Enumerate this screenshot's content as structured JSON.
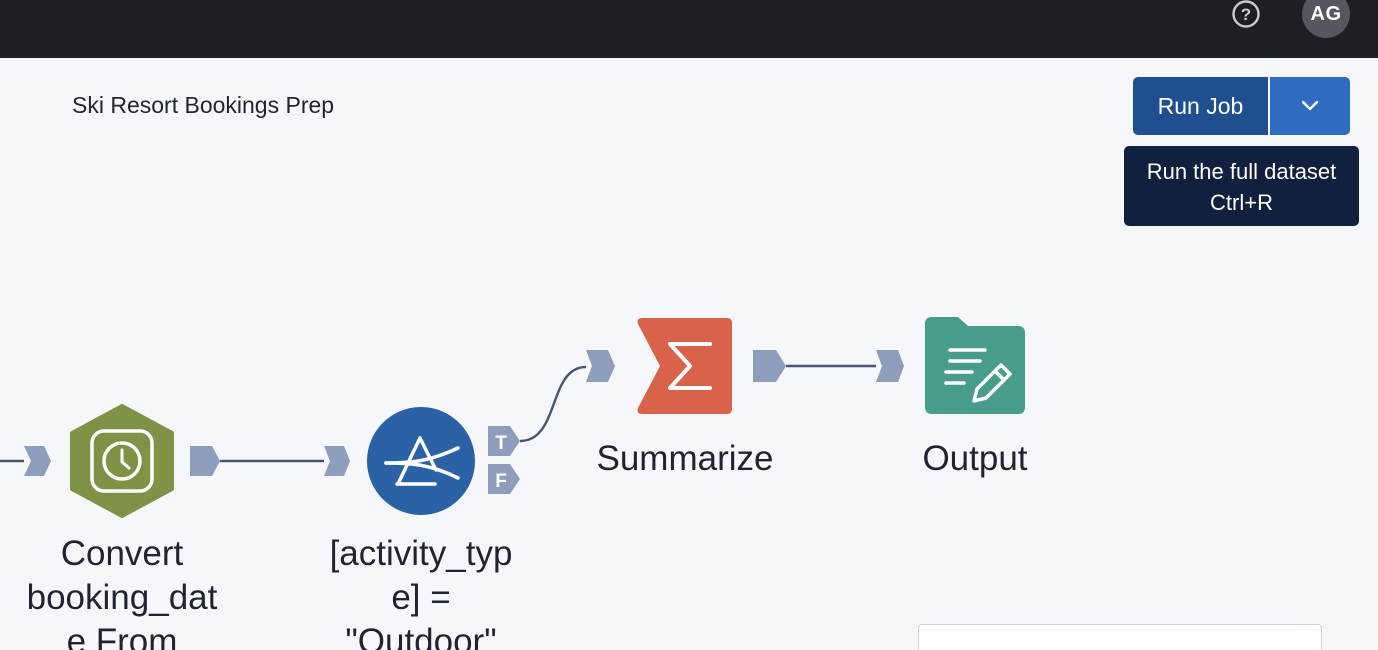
{
  "header": {
    "help_icon": "question-circle-icon",
    "avatar_initials": "AG"
  },
  "workflow": {
    "title": "Ski Resort Bookings Prep"
  },
  "run": {
    "button_label": "Run Job",
    "dropdown_icon": "chevron-down-icon",
    "tooltip_line1": "Run the full dataset",
    "tooltip_line2": "Ctrl+R"
  },
  "nodes": {
    "datetime": {
      "label_lines": [
        "Convert",
        "booking_dat",
        "e From"
      ],
      "icon": "clock-icon",
      "color": "#7f9245"
    },
    "filter": {
      "label_lines": [
        "[activity_typ",
        "e] =",
        "\"Outdoor\""
      ],
      "icon": "filter-icon",
      "color": "#2a62a5",
      "true_anchor": "T",
      "false_anchor": "F"
    },
    "summarize": {
      "label": "Summarize",
      "icon": "sigma-icon",
      "color": "#d9624b"
    },
    "output": {
      "label": "Output",
      "icon": "output-folder-icon",
      "color": "#479c8c"
    }
  },
  "colors": {
    "anchor": "#8d9dbb",
    "connector": "#4a5570",
    "topbar": "#1e1f24",
    "run_button": "#1f4f8f",
    "run_dropdown": "#2f6bc1",
    "tooltip": "#12203f"
  }
}
